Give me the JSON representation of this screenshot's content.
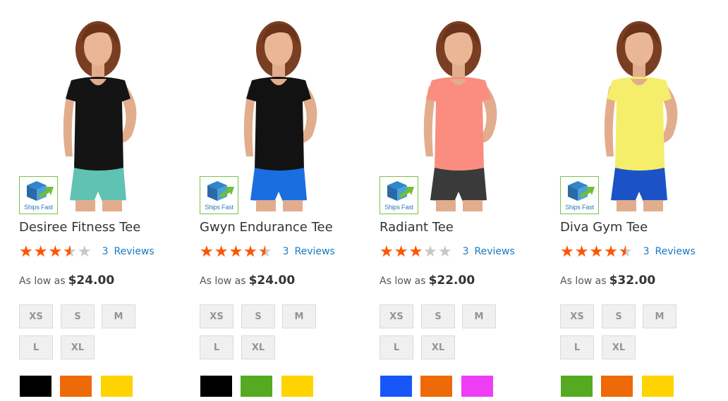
{
  "badge_label": "Ships Fast",
  "price_prefix": "As low as",
  "review_word": "Reviews",
  "sizes": [
    "XS",
    "S",
    "M",
    "L",
    "XL"
  ],
  "colors": {
    "star_filled": "#ff5501",
    "star_empty": "#c7c7c7",
    "link": "#1979c3",
    "badge_border": "#7bc24a"
  },
  "products": [
    {
      "name": "Desiree Fitness Tee",
      "rating": 3.5,
      "review_count": "3",
      "price": "$24.00",
      "shirt_color": "#141414",
      "shorts_color": "#5fc2b3",
      "swatches": [
        "#000000",
        "#ee6a08",
        "#ffd300"
      ]
    },
    {
      "name": "Gwyn Endurance Tee",
      "rating": 4.5,
      "review_count": "3",
      "price": "$24.00",
      "shirt_color": "#121212",
      "shorts_color": "#1a6ee0",
      "swatches": [
        "#000000",
        "#55aa22",
        "#ffd300"
      ]
    },
    {
      "name": "Radiant Tee",
      "rating": 3,
      "review_count": "3",
      "price": "$22.00",
      "shirt_color": "#fb8d80",
      "shorts_color": "#3a3a3a",
      "swatches": [
        "#1757f7",
        "#ee6a08",
        "#ee3ef5"
      ]
    },
    {
      "name": "Diva Gym Tee",
      "rating": 4.5,
      "review_count": "3",
      "price": "$32.00",
      "shirt_color": "#f4ee6a",
      "shorts_color": "#1b53c6",
      "swatches": [
        "#55aa22",
        "#ee6a08",
        "#ffd300"
      ]
    }
  ]
}
